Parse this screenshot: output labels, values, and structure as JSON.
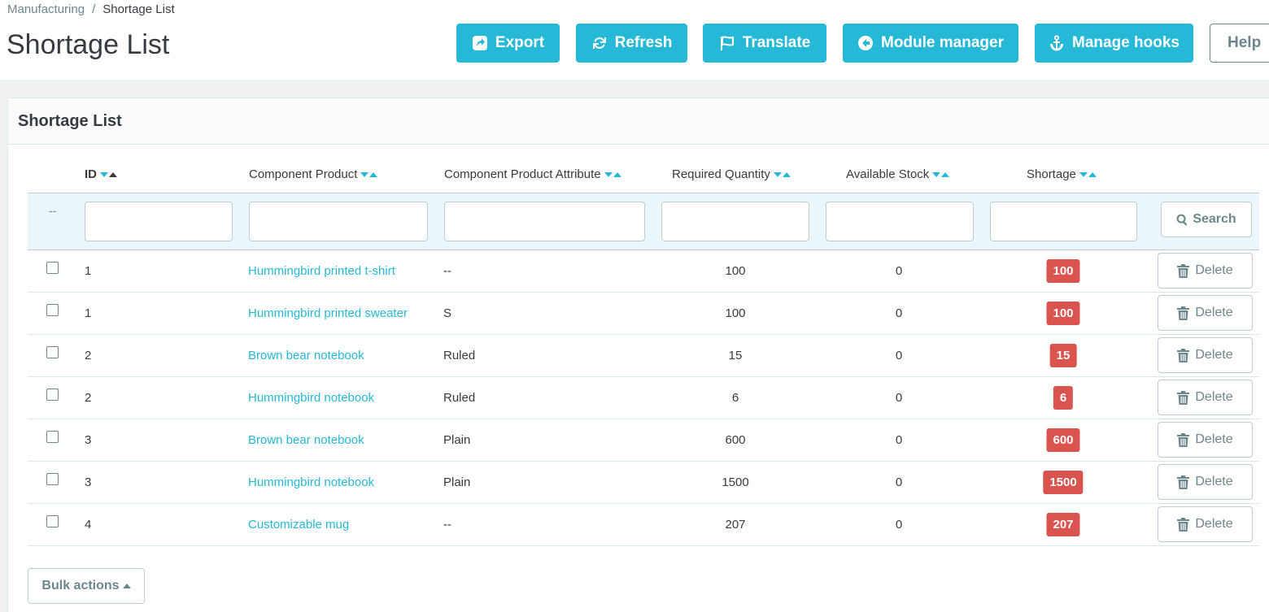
{
  "breadcrumb": {
    "parent": "Manufacturing",
    "separator": "/",
    "current": "Shortage List"
  },
  "page_title": "Shortage List",
  "toolbar": {
    "export": "Export",
    "refresh": "Refresh",
    "translate": "Translate",
    "module_manager": "Module manager",
    "manage_hooks": "Manage hooks",
    "help": "Help"
  },
  "panel": {
    "title": "Shortage List"
  },
  "table": {
    "columns": [
      "ID",
      "Component Product",
      "Component Product Attribute",
      "Required Quantity",
      "Available Stock",
      "Shortage"
    ],
    "filter_placeholder": "--",
    "search_label": "Search",
    "delete_label": "Delete",
    "rows": [
      {
        "id": "1",
        "product": "Hummingbird printed t-shirt",
        "attribute": "--",
        "required": "100",
        "available": "0",
        "shortage": "100"
      },
      {
        "id": "1",
        "product": "Hummingbird printed sweater",
        "attribute": "S",
        "required": "100",
        "available": "0",
        "shortage": "100"
      },
      {
        "id": "2",
        "product": "Brown bear notebook",
        "attribute": "Ruled",
        "required": "15",
        "available": "0",
        "shortage": "15"
      },
      {
        "id": "2",
        "product": "Hummingbird notebook",
        "attribute": "Ruled",
        "required": "6",
        "available": "0",
        "shortage": "6"
      },
      {
        "id": "3",
        "product": "Brown bear notebook",
        "attribute": "Plain",
        "required": "600",
        "available": "0",
        "shortage": "600"
      },
      {
        "id": "3",
        "product": "Hummingbird notebook",
        "attribute": "Plain",
        "required": "1500",
        "available": "0",
        "shortage": "1500"
      },
      {
        "id": "4",
        "product": "Customizable mug",
        "attribute": "--",
        "required": "207",
        "available": "0",
        "shortage": "207"
      }
    ]
  },
  "bulk_actions": "Bulk actions",
  "colors": {
    "primary": "#25b9d7",
    "danger": "#d9534f",
    "text": "#363a41",
    "muted": "#6c868e"
  }
}
